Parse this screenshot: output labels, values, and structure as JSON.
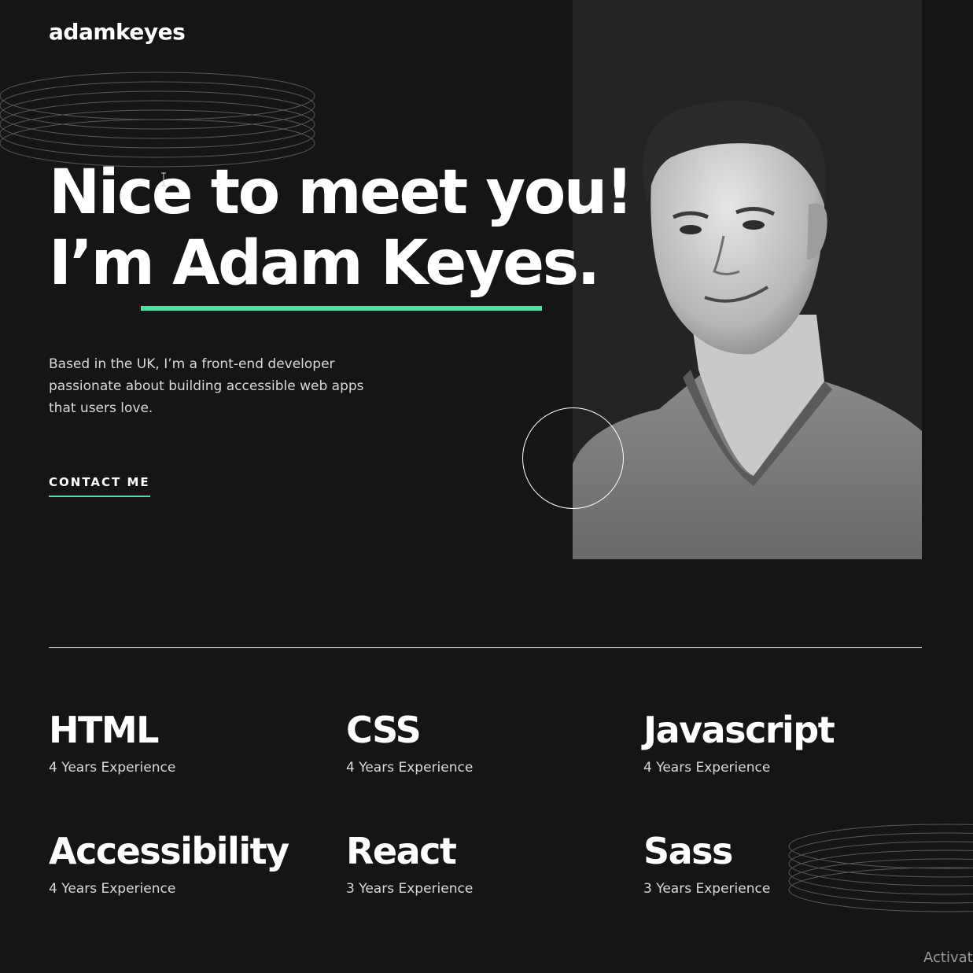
{
  "header": {
    "logo": "adamkeyes"
  },
  "hero": {
    "title_line1": "Nice to meet you!",
    "title_line2": "I’m Adam Keyes.",
    "description": "Based in the UK, I’m a front-end developer passionate about building accessible web apps that users love.",
    "cta_label": "CONTACT ME"
  },
  "skills": [
    {
      "name": "HTML",
      "experience": "4 Years Experience"
    },
    {
      "name": "CSS",
      "experience": "4 Years Experience"
    },
    {
      "name": "Javascript",
      "experience": "4 Years Experience"
    },
    {
      "name": "Accessibility",
      "experience": "4 Years Experience"
    },
    {
      "name": "React",
      "experience": "3 Years Experience"
    },
    {
      "name": "Sass",
      "experience": "3 Years Experience"
    }
  ],
  "overlay": {
    "watermark": "Activate"
  },
  "colors": {
    "accent": "#4ee1a0",
    "background": "#151515",
    "panel": "#242424"
  }
}
